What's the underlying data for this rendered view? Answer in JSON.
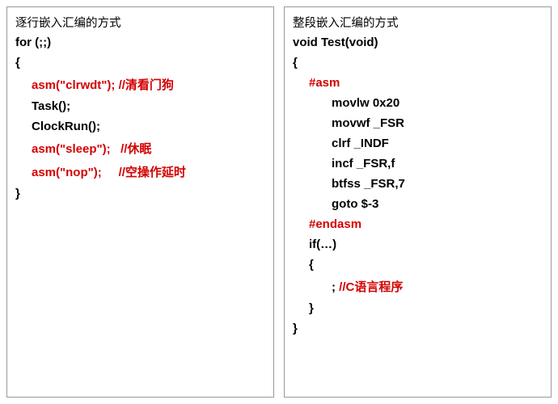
{
  "left": {
    "title": "逐行嵌入汇编的方式",
    "l1": "for (;;)",
    "l2": "{",
    "l3a": "asm(\"clrwdt\"); ",
    "l3b": "//清看门狗",
    "l4": "Task();",
    "l5": "ClockRun();",
    "l6a": "asm(\"sleep\");   ",
    "l6b": "//休眠",
    "l7a": "asm(\"nop\");     ",
    "l7b": "//空操作延时",
    "l8": "}"
  },
  "right": {
    "title": "整段嵌入汇编的方式",
    "l1": "void Test(void)",
    "l2": "{",
    "l3": "#asm",
    "l4": "movlw 0x20",
    "l5": "movwf _FSR",
    "l6": "clrf _INDF",
    "l7": "incf _FSR,f",
    "l8": "btfss _FSR,7",
    "l9": "goto $-3",
    "l10": "#endasm",
    "l11": "if(…)",
    "l12": "{",
    "l13a": "; ",
    "l13b": "//C语言程序",
    "l14": "}",
    "l15": "}"
  }
}
